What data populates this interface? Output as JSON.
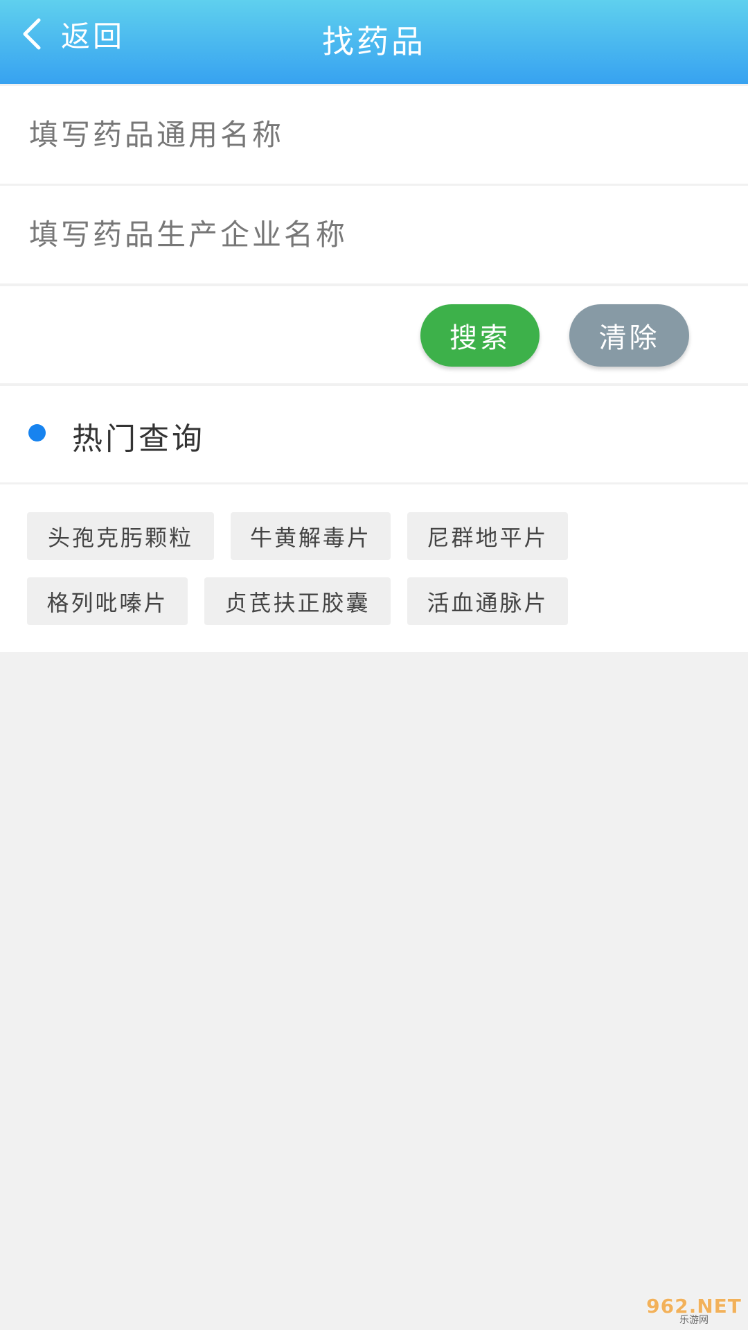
{
  "header": {
    "back_label": "返回",
    "title": "找药品"
  },
  "form": {
    "drug_name_placeholder": "填写药品通用名称",
    "drug_name_value": "",
    "manufacturer_placeholder": "填写药品生产企业名称",
    "manufacturer_value": "",
    "search_label": "搜索",
    "clear_label": "清除"
  },
  "hot": {
    "title": "热门查询",
    "tags": [
      "头孢克肟颗粒",
      "牛黄解毒片",
      "尼群地平片",
      "格列吡嗪片",
      "贞芪扶正胶囊",
      "活血通脉片"
    ]
  },
  "watermark": {
    "main": "962.NET",
    "sub": "乐游网"
  },
  "colors": {
    "header_top": "#5fd0ee",
    "header_bottom": "#37a2f0",
    "search_button": "#3db14a",
    "clear_button": "#879aa5",
    "hot_dot": "#1783ef",
    "tag_bg": "#efefef"
  }
}
